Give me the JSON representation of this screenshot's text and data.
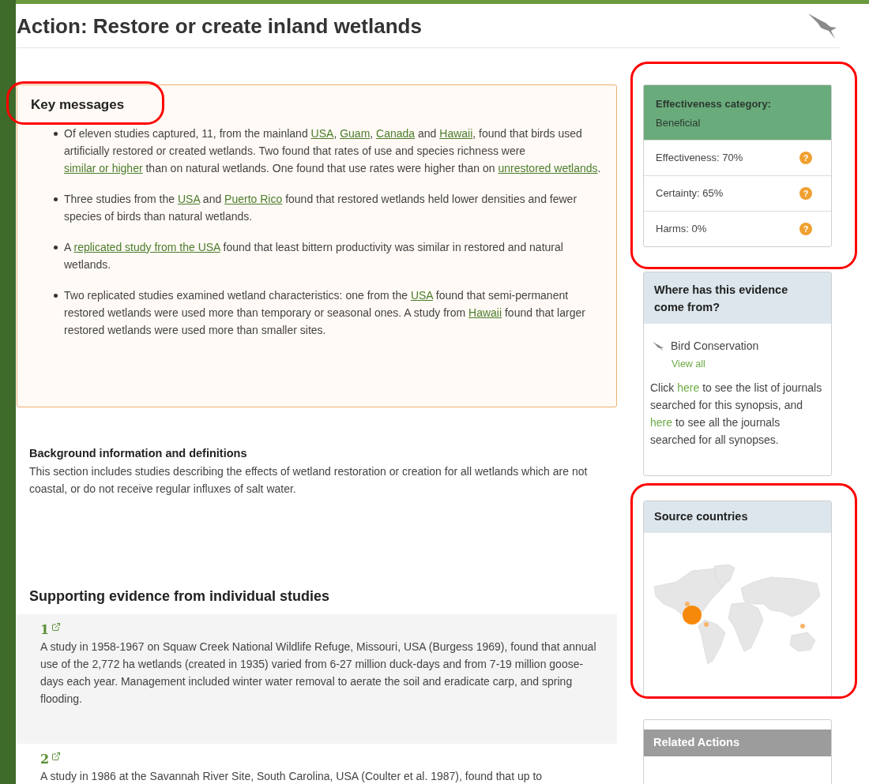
{
  "page": {
    "title": "Action: Restore or create inland wetlands"
  },
  "key_messages": {
    "heading": "Key messages",
    "highlighted": true,
    "items": [
      {
        "parts": [
          {
            "kind": "text",
            "text": "Of eleven studies captured, 11, from the mainland "
          },
          {
            "kind": "link",
            "text": "USA"
          },
          {
            "kind": "text",
            "text": ", "
          },
          {
            "kind": "link",
            "text": "Guam"
          },
          {
            "kind": "text",
            "text": ", "
          },
          {
            "kind": "link",
            "text": "Canada"
          },
          {
            "kind": "text",
            "text": " and "
          },
          {
            "kind": "link",
            "text": "Hawaii"
          },
          {
            "kind": "text",
            "text": ", found that birds used artificially restored or created wetlands. Two found that rates of use and species richness were "
          },
          {
            "kind": "link",
            "text": "similar or higher"
          },
          {
            "kind": "text",
            "text": " than on natural wetlands. One found that use rates were higher than on "
          },
          {
            "kind": "link",
            "text": "unrestored wetlands"
          },
          {
            "kind": "text",
            "text": "."
          }
        ]
      },
      {
        "parts": [
          {
            "kind": "text",
            "text": "Three studies from the "
          },
          {
            "kind": "link",
            "text": "USA"
          },
          {
            "kind": "text",
            "text": " and "
          },
          {
            "kind": "link",
            "text": "Puerto Rico"
          },
          {
            "kind": "text",
            "text": " found that restored wetlands held lower densities and fewer species of birds than natural wetlands."
          }
        ]
      },
      {
        "parts": [
          {
            "kind": "text",
            "text": "A "
          },
          {
            "kind": "link",
            "text": "replicated study from the USA"
          },
          {
            "kind": "text",
            "text": " found that least bittern productivity was similar in restored and natural wetlands."
          }
        ]
      },
      {
        "parts": [
          {
            "kind": "text",
            "text": "Two replicated studies examined wetland characteristics: one from the "
          },
          {
            "kind": "link",
            "text": "USA"
          },
          {
            "kind": "text",
            "text": " found that semi-permanent restored wetlands were used more than temporary or seasonal ones. A study from "
          },
          {
            "kind": "link",
            "text": "Hawaii"
          },
          {
            "kind": "text",
            "text": " found that larger restored wetlands were used more than smaller sites."
          }
        ]
      }
    ]
  },
  "background": {
    "heading": "Background information and definitions",
    "text": "This section includes studies describing the effects of wetland restoration or creation for all wetlands which are not coastal, or do not receive regular influxes of salt water."
  },
  "evidence": {
    "heading": "Supporting evidence from individual studies",
    "studies": [
      {
        "number": "1",
        "shaded": true,
        "text": "A study in 1958-1967 on Squaw Creek National Wildlife Refuge, Missouri, USA (Burgess 1969), found that annual use of the 2,772 ha wetlands (created in 1935)  varied from 6-27 million duck-days and from 7-19 million goose-days each year. Management included winter water removal to aerate the soil and eradicate carp, and spring flooding."
      },
      {
        "number": "2",
        "shaded": false,
        "text": "A study in 1986 at the Savannah River Site, South Carolina, USA (Coulter et al. 1987), found that up to"
      }
    ]
  },
  "effectiveness": {
    "highlighted": true,
    "heading": "Effectiveness category:",
    "category": "Beneficial",
    "rows": [
      {
        "label": "Effectiveness: 70%",
        "help": "?"
      },
      {
        "label": "Certainty: 65%",
        "help": "?"
      },
      {
        "label": "Harms: 0%",
        "help": "?"
      }
    ]
  },
  "evidence_source": {
    "heading": "Where has this evidence come from?",
    "synopsis": "Bird Conservation",
    "view_all": "View all",
    "parts": [
      {
        "kind": "text",
        "text": "Click "
      },
      {
        "kind": "link",
        "text": "here"
      },
      {
        "kind": "text",
        "text": " to see the list of journals searched for this synopsis, and "
      },
      {
        "kind": "link",
        "text": "here"
      },
      {
        "kind": "text",
        "text": " to see all the journals searched for all synopses."
      }
    ]
  },
  "source_countries": {
    "heading": "Source countries",
    "highlighted": true
  },
  "related_actions": {
    "heading": "Related Actions"
  }
}
